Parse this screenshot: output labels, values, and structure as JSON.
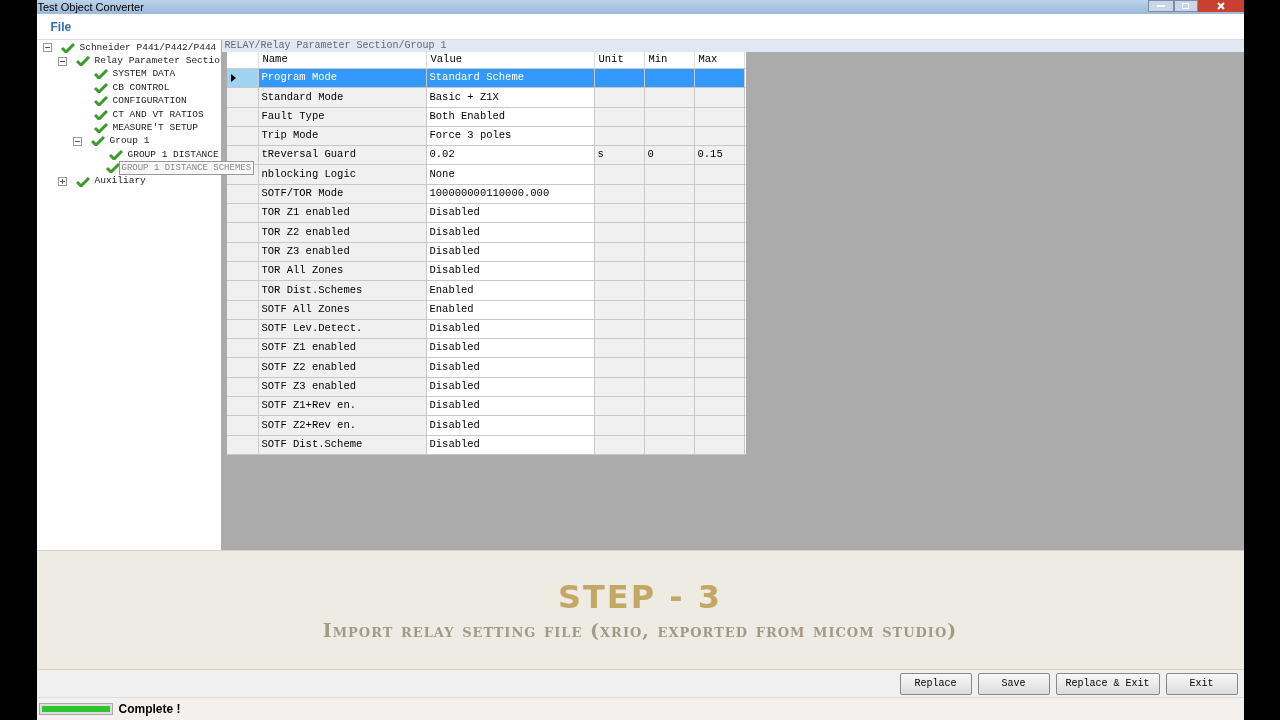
{
  "window": {
    "title": "Test Object Converter"
  },
  "menu": [
    "File"
  ],
  "tree": [
    {
      "label": "Schneider P441/P442/P444",
      "expanded": true,
      "children": [
        {
          "label": "Relay Parameter Sectio",
          "expanded": true,
          "children": [
            {
              "label": "SYSTEM DATA"
            },
            {
              "label": "CB CONTROL"
            },
            {
              "label": "CONFIGURATION"
            },
            {
              "label": "CT AND VT RATIOS"
            },
            {
              "label": "MEASURE'T SETUP"
            },
            {
              "label": "Group 1",
              "expanded": true,
              "children": [
                {
                  "label": "GROUP 1 DISTANCE"
                },
                {
                  "label": "GROUP 1 DISTANCE SCHEMES",
                  "kind": "tooltip"
                }
              ]
            }
          ]
        },
        {
          "label": "Auxiliary",
          "expanded": false
        }
      ]
    }
  ],
  "path": "RELAY/Relay Parameter Section/Group 1",
  "table": {
    "columns": [
      "Name",
      "Value",
      "Unit",
      "Min",
      "Max"
    ],
    "rows": [
      {
        "cells": [
          "Program Mode",
          "Standard Scheme",
          "",
          "",
          ""
        ],
        "selected": true
      },
      {
        "cells": [
          "Standard Mode",
          "Basic + Z1X",
          "",
          "",
          ""
        ],
        "selected": false
      },
      {
        "cells": [
          "Fault Type",
          "Both Enabled",
          "",
          "",
          ""
        ],
        "selected": false
      },
      {
        "cells": [
          "Trip Mode",
          "Force 3 poles",
          "",
          "",
          ""
        ],
        "selected": false
      },
      {
        "cells": [
          "tReversal Guard",
          "0.02",
          "s",
          "0",
          "0.15"
        ],
        "selected": false
      },
      {
        "cells": [
          "nblocking Logic",
          "None",
          "",
          "",
          ""
        ],
        "selected": false
      },
      {
        "cells": [
          "SOTF/TOR Mode",
          "100000000110000.000",
          "",
          "",
          ""
        ],
        "selected": false
      },
      {
        "cells": [
          "TOR Z1 enabled",
          "Disabled",
          "",
          "",
          ""
        ],
        "selected": false
      },
      {
        "cells": [
          "TOR Z2 enabled",
          "Disabled",
          "",
          "",
          ""
        ],
        "selected": false
      },
      {
        "cells": [
          "TOR Z3 enabled",
          "Disabled",
          "",
          "",
          ""
        ],
        "selected": false
      },
      {
        "cells": [
          "TOR All Zones",
          "Disabled",
          "",
          "",
          ""
        ],
        "selected": false
      },
      {
        "cells": [
          "TOR Dist.Schemes",
          "Enabled",
          "",
          "",
          ""
        ],
        "selected": false
      },
      {
        "cells": [
          "SOTF All Zones",
          "Enabled",
          "",
          "",
          ""
        ],
        "selected": false
      },
      {
        "cells": [
          "SOTF Lev.Detect.",
          "Disabled",
          "",
          "",
          ""
        ],
        "selected": false
      },
      {
        "cells": [
          "SOTF Z1 enabled",
          "Disabled",
          "",
          "",
          ""
        ],
        "selected": false
      },
      {
        "cells": [
          "SOTF Z2 enabled",
          "Disabled",
          "",
          "",
          ""
        ],
        "selected": false
      },
      {
        "cells": [
          "SOTF Z3 enabled",
          "Disabled",
          "",
          "",
          ""
        ],
        "selected": false
      },
      {
        "cells": [
          "SOTF Z1+Rev en.",
          "Disabled",
          "",
          "",
          ""
        ],
        "selected": false
      },
      {
        "cells": [
          "SOTF Z2+Rev en.",
          "Disabled",
          "",
          "",
          ""
        ],
        "selected": false
      },
      {
        "cells": [
          "SOTF Dist.Scheme",
          "Disabled",
          "",
          "",
          ""
        ],
        "selected": false
      }
    ]
  },
  "banner": {
    "title": "STEP - 3",
    "subtitle": "Import relay setting file (xrio, exported from micom studio)"
  },
  "buttons": [
    "Replace",
    "Save",
    "Replace & Exit",
    "Exit"
  ],
  "status": {
    "level": 1,
    "text": "Complete !"
  }
}
